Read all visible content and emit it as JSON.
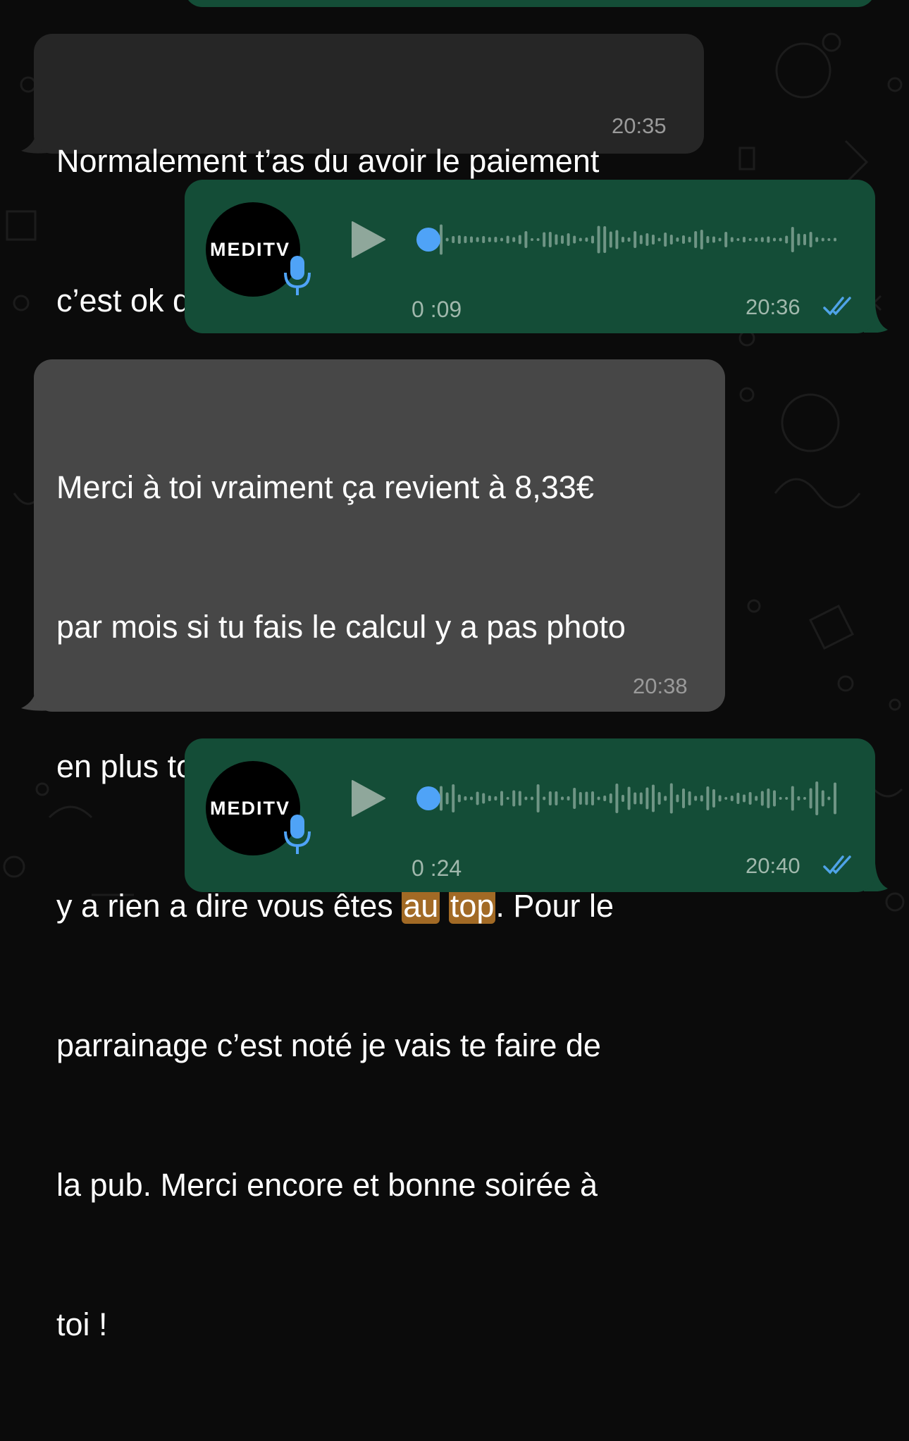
{
  "messages": [
    {
      "type": "text",
      "direction": "incoming",
      "lines": [
        "Normalement t’as du avoir le paiement",
        "c’est ok de mon côté"
      ],
      "time": "20:35"
    },
    {
      "type": "voice",
      "direction": "outgoing",
      "avatar_label": "MEDITV",
      "duration": "0 :09",
      "time": "20:36",
      "status": "read"
    },
    {
      "type": "text",
      "direction": "incoming",
      "lines": [
        "Merci à toi vraiment ça revient à 8,33€",
        "par mois si tu fais le calcul y a pas photo",
        "en plus toutes les chaînes et du full HD",
        "y a rien a dire vous êtes ",
        "au",
        " ",
        "top",
        ". Pour le",
        "parrainage c’est noté je vais te faire de",
        "la pub. Merci encore et bonne soirée à",
        "toi !"
      ],
      "time": "20:38"
    },
    {
      "type": "voice",
      "direction": "outgoing",
      "avatar_label": "MEDITV",
      "duration": "0 :24",
      "time": "20:40",
      "status": "read"
    }
  ],
  "colors": {
    "background": "#0b0b0b",
    "incoming_bubble": "#262626",
    "incoming_bubble_highlighted": "#474747",
    "outgoing_bubble": "#144d37",
    "read_ticks": "#4fa3e8",
    "playhead": "#4fa3f7",
    "search_highlight": "#a26a25"
  },
  "icons": [
    "play-icon",
    "microphone-icon",
    "double-check-icon"
  ]
}
